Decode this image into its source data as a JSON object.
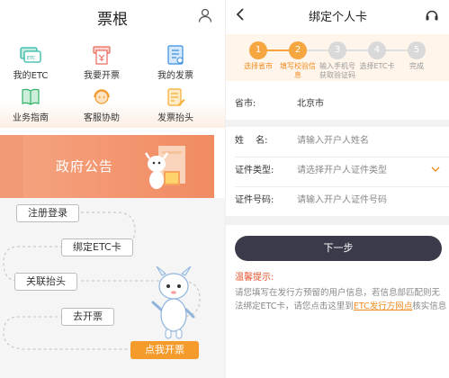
{
  "left": {
    "title": "票根",
    "grid": [
      {
        "label": "我的ETC",
        "icon": "etc-card-icon",
        "color": "#31b6a5"
      },
      {
        "label": "我要开票",
        "icon": "print-invoice-icon",
        "color": "#e9685a"
      },
      {
        "label": "我的发票",
        "icon": "my-invoice-icon",
        "color": "#3a8ee0"
      },
      {
        "label": "业务指南",
        "icon": "guide-book-icon",
        "color": "#33b36a"
      },
      {
        "label": "客服协助",
        "icon": "customer-service-icon",
        "color": "#f39a2c"
      },
      {
        "label": "发票抬头",
        "icon": "invoice-title-icon",
        "color": "#f6ad35"
      }
    ],
    "banner": "政府公告",
    "flow_steps": [
      "注册登录",
      "绑定ETC卡",
      "关联抬头",
      "去开票"
    ],
    "cta": "点我开票"
  },
  "right": {
    "title": "绑定个人卡",
    "steps": [
      {
        "num": "1",
        "label": "选择省市",
        "state": "done"
      },
      {
        "num": "2",
        "label": "填写校验信息",
        "state": "active"
      },
      {
        "num": "3",
        "label": "输入手机号获取验证码",
        "state": "todo"
      },
      {
        "num": "4",
        "label": "选择ETC卡",
        "state": "todo"
      },
      {
        "num": "5",
        "label": "完成",
        "state": "todo"
      }
    ],
    "province_label": "省市:",
    "province_value": "北京市",
    "name_label": "姓　 名:",
    "name_placeholder": "请输入开户人姓名",
    "id_type_label": "证件类型:",
    "id_type_placeholder": "请选择开户人证件类型",
    "id_no_label": "证件号码:",
    "id_no_placeholder": "请输入开户人证件号码",
    "next_button": "下一步",
    "tip_title": "温馨提示:",
    "tip_text_before": "请您填写在发行方预留的用户信息，若信息部匹配则无法绑定ETC卡，请您点击这里到",
    "tip_link": "ETC发行方网点",
    "tip_text_after": "核实信息"
  },
  "colors": {
    "accent_orange": "#f59b2c",
    "step_active": "#f5a640",
    "step_todo": "#d9d9d9",
    "button_dark": "#3a3a4a",
    "tip_red": "#e8522c"
  }
}
